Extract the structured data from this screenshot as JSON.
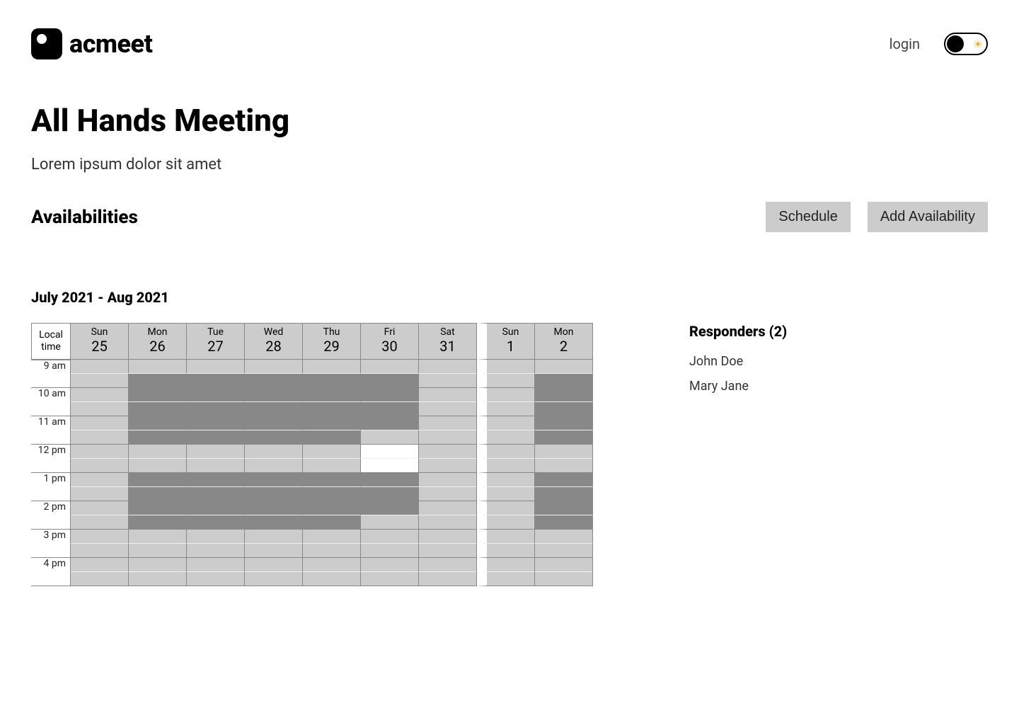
{
  "header": {
    "brand": "acmeet",
    "login_label": "login"
  },
  "meeting": {
    "title": "All Hands Meeting",
    "description": "Lorem ipsum dolor sit amet"
  },
  "section": {
    "title": "Availabilities",
    "schedule_btn": "Schedule",
    "add_btn": "Add Availability"
  },
  "calendar": {
    "range_label": "July 2021 - Aug  2021",
    "tz_label": "Local time",
    "days": [
      {
        "dow": "Sun",
        "num": "25",
        "week_start": false
      },
      {
        "dow": "Mon",
        "num": "26",
        "week_start": false
      },
      {
        "dow": "Tue",
        "num": "27",
        "week_start": false
      },
      {
        "dow": "Wed",
        "num": "28",
        "week_start": false
      },
      {
        "dow": "Thu",
        "num": "29",
        "week_start": false
      },
      {
        "dow": "Fri",
        "num": "30",
        "week_start": false
      },
      {
        "dow": "Sat",
        "num": "31",
        "week_start": false
      },
      {
        "dow": "Sun",
        "num": "1",
        "week_start": true
      },
      {
        "dow": "Mon",
        "num": "2",
        "week_start": false
      }
    ],
    "times": [
      "9 am",
      "10 am",
      "11 am",
      "12 pm",
      "1 pm",
      "2 pm",
      "3 pm",
      "4 pm"
    ],
    "availability": {
      "0": [
        0,
        0,
        0,
        0,
        0,
        0,
        0,
        0,
        0,
        0,
        0,
        0,
        0,
        0,
        0,
        0
      ],
      "1": [
        0,
        1,
        1,
        1,
        1,
        1,
        0,
        0,
        1,
        1,
        1,
        1,
        0,
        0,
        0,
        0
      ],
      "2": [
        0,
        1,
        1,
        1,
        1,
        1,
        0,
        0,
        1,
        1,
        1,
        1,
        0,
        0,
        0,
        0
      ],
      "3": [
        0,
        1,
        1,
        1,
        1,
        1,
        0,
        0,
        1,
        1,
        1,
        1,
        0,
        0,
        0,
        0
      ],
      "4": [
        0,
        1,
        1,
        1,
        1,
        1,
        0,
        0,
        1,
        1,
        1,
        1,
        0,
        0,
        0,
        0
      ],
      "5": [
        0,
        1,
        1,
        1,
        1,
        0,
        2,
        2,
        1,
        1,
        1,
        0,
        0,
        0,
        0,
        0
      ],
      "6": [
        0,
        0,
        0,
        0,
        0,
        0,
        0,
        0,
        0,
        0,
        0,
        0,
        0,
        0,
        0,
        0
      ],
      "7": [
        0,
        0,
        0,
        0,
        0,
        0,
        0,
        0,
        0,
        0,
        0,
        0,
        0,
        0,
        0,
        0
      ],
      "8": [
        0,
        1,
        1,
        1,
        1,
        1,
        0,
        0,
        1,
        1,
        1,
        1,
        0,
        0,
        0,
        0
      ]
    }
  },
  "responders": {
    "title": "Responders  (2)",
    "people": [
      "John Doe",
      "Mary Jane"
    ]
  }
}
